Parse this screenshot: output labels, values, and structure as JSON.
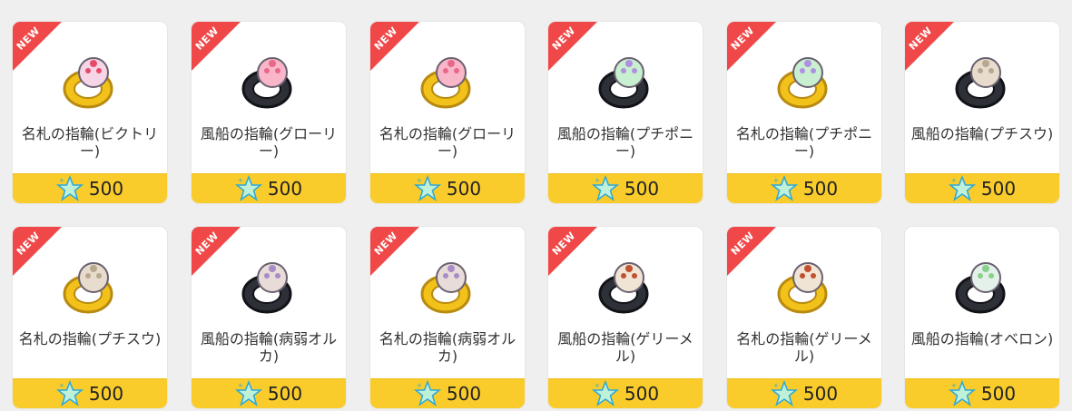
{
  "badge_text": "NEW",
  "currency_icon": "star-point-icon",
  "colors": {
    "badge": "#f04848",
    "price_bar": "#f9cc2c",
    "gold_band": "#f2c21b",
    "dark_band": "#2e3038"
  },
  "items": [
    {
      "name": "名札の指輪(ビクトリー)",
      "price": "500",
      "is_new": true,
      "band": "gold",
      "ornament": "victory"
    },
    {
      "name": "風船の指輪(グローリー)",
      "price": "500",
      "is_new": true,
      "band": "dark",
      "ornament": "glory"
    },
    {
      "name": "名札の指輪(グローリー)",
      "price": "500",
      "is_new": true,
      "band": "gold",
      "ornament": "glory"
    },
    {
      "name": "風船の指輪(プチポニー)",
      "price": "500",
      "is_new": true,
      "band": "dark",
      "ornament": "pony"
    },
    {
      "name": "名札の指輪(プチポニー)",
      "price": "500",
      "is_new": true,
      "band": "gold",
      "ornament": "pony"
    },
    {
      "name": "風船の指輪(プチスウ)",
      "price": "500",
      "is_new": true,
      "band": "dark",
      "ornament": "suu"
    },
    {
      "name": "名札の指輪(プチスウ)",
      "price": "500",
      "is_new": true,
      "band": "gold",
      "ornament": "suu"
    },
    {
      "name": "風船の指輪(病弱オルカ)",
      "price": "500",
      "is_new": true,
      "band": "dark",
      "ornament": "orca"
    },
    {
      "name": "名札の指輪(病弱オルカ)",
      "price": "500",
      "is_new": true,
      "band": "gold",
      "ornament": "orca"
    },
    {
      "name": "風船の指輪(ゲリーメル)",
      "price": "500",
      "is_new": true,
      "band": "dark",
      "ornament": "gerimel"
    },
    {
      "name": "名札の指輪(ゲリーメル)",
      "price": "500",
      "is_new": true,
      "band": "gold",
      "ornament": "gerimel"
    },
    {
      "name": "風船の指輪(オベロン)",
      "price": "500",
      "is_new": false,
      "band": "dark",
      "ornament": "oberon"
    }
  ]
}
